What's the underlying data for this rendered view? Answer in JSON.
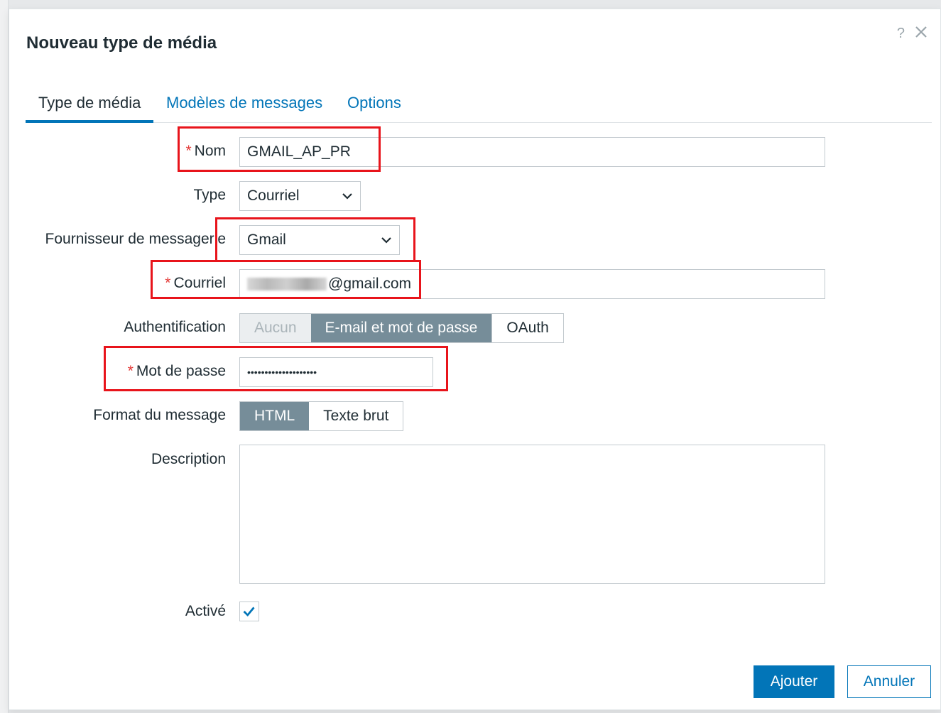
{
  "dialog": {
    "title": "Nouveau type de média",
    "help_glyph": "?"
  },
  "tabs": [
    {
      "label": "Type de média",
      "active": true
    },
    {
      "label": "Modèles de messages",
      "active": false
    },
    {
      "label": "Options",
      "active": false
    }
  ],
  "form": {
    "name": {
      "label": "Nom",
      "required": true,
      "value": "GMAIL_AP_PR"
    },
    "type": {
      "label": "Type",
      "value": "Courriel"
    },
    "provider": {
      "label": "Fournisseur de messagerie",
      "value": "Gmail"
    },
    "email": {
      "label": "Courriel",
      "required": true,
      "value_visible": "@gmail.com"
    },
    "auth": {
      "label": "Authentification",
      "options": [
        "Aucun",
        "E-mail et mot de passe",
        "OAuth"
      ],
      "selected": "E-mail et mot de passe",
      "disabled": [
        "Aucun"
      ]
    },
    "password": {
      "label": "Mot de passe",
      "required": true,
      "value": "••••••••••••••••••••"
    },
    "message_format": {
      "label": "Format du message",
      "options": [
        "HTML",
        "Texte brut"
      ],
      "selected": "HTML"
    },
    "description": {
      "label": "Description",
      "value": ""
    },
    "enabled": {
      "label": "Activé",
      "checked": true
    }
  },
  "buttons": {
    "add": "Ajouter",
    "cancel": "Annuler"
  },
  "colors": {
    "accent": "#0275b8",
    "selected_segment": "#768d99",
    "required_star": "#e33734",
    "highlight_box": "#e8141b"
  },
  "icons": {
    "help": "help-icon",
    "close": "close-icon",
    "dropdown": "chevron-down-icon",
    "check": "check-icon"
  }
}
